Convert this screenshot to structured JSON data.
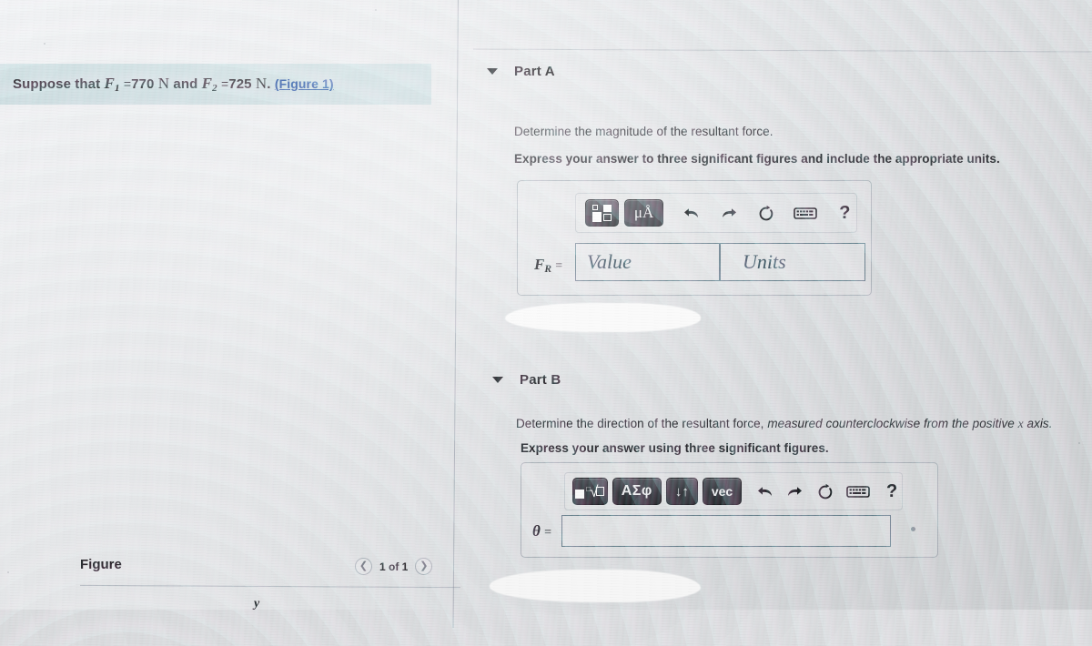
{
  "question": {
    "prefix": "Suppose that",
    "f1_symbol": "F",
    "f1_sub": "1",
    "f1_eq": "=",
    "f1_value": "770",
    "f1_unit": "N",
    "conjunction": "and",
    "f2_symbol": "F",
    "f2_sub": "2",
    "f2_eq": "=",
    "f2_value": "725",
    "f2_unit": "N",
    "period": ".",
    "figure_link": "(Figure 1)"
  },
  "figure_panel": {
    "heading": "Figure",
    "pager_label": "1 of 1",
    "prev_icon": "chevron-left",
    "next_icon": "chevron-right",
    "axis_y_label": "y"
  },
  "parts": [
    {
      "id": "A",
      "title": "Part A",
      "prompt": "Determine the magnitude of the resultant force.",
      "instruction": "Express your answer to three significant figures and include the appropriate units.",
      "toolbar": [
        {
          "name": "math-template-button",
          "label": "",
          "kind": "template"
        },
        {
          "name": "units-button",
          "label": "μÅ",
          "kind": "mu"
        },
        {
          "name": "undo-button",
          "label": "↩",
          "kind": "icon"
        },
        {
          "name": "redo-button",
          "label": "↪",
          "kind": "icon"
        },
        {
          "name": "reset-button",
          "label": "↻",
          "kind": "icon"
        },
        {
          "name": "keyboard-button",
          "label": "⌨",
          "kind": "icon"
        },
        {
          "name": "help-button",
          "label": "?",
          "kind": "icon"
        }
      ],
      "answer": {
        "label_symbol": "F",
        "label_sub": "R",
        "label_eq": "=",
        "value_placeholder": "Value",
        "value_text": "",
        "units_placeholder": "Units",
        "units_text": ""
      }
    },
    {
      "id": "B",
      "title": "Part B",
      "prompt_plain": "Determine the direction of the resultant force,",
      "prompt_italic": "measured counterclockwise from the positive",
      "prompt_var": "x",
      "prompt_tail": "axis.",
      "instruction": "Express your answer using three significant figures.",
      "toolbar": [
        {
          "name": "math-template-button",
          "label": "",
          "kind": "template-b"
        },
        {
          "name": "greek-symbols-button",
          "label": "ΑΣφ",
          "kind": "greek"
        },
        {
          "name": "sort-arrows-button",
          "label": "↓↑",
          "kind": "arrows"
        },
        {
          "name": "vector-button",
          "label": "vec",
          "kind": "vec"
        },
        {
          "name": "undo-button",
          "label": "↩",
          "kind": "icon"
        },
        {
          "name": "redo-button",
          "label": "↪",
          "kind": "icon"
        },
        {
          "name": "reset-button",
          "label": "↻",
          "kind": "icon"
        },
        {
          "name": "keyboard-button",
          "label": "⌨",
          "kind": "icon"
        },
        {
          "name": "help-button",
          "label": "?",
          "kind": "icon"
        }
      ],
      "answer": {
        "label_symbol": "θ",
        "label_eq": "=",
        "value_text": "",
        "unit_marker": "°"
      }
    }
  ],
  "colors": {
    "banner": "#c6dde1",
    "link": "#1d4fa0",
    "field_border": "#5d7a86",
    "toolbar_button": "#2e3237",
    "placeholder_text": "#2f4a57"
  }
}
